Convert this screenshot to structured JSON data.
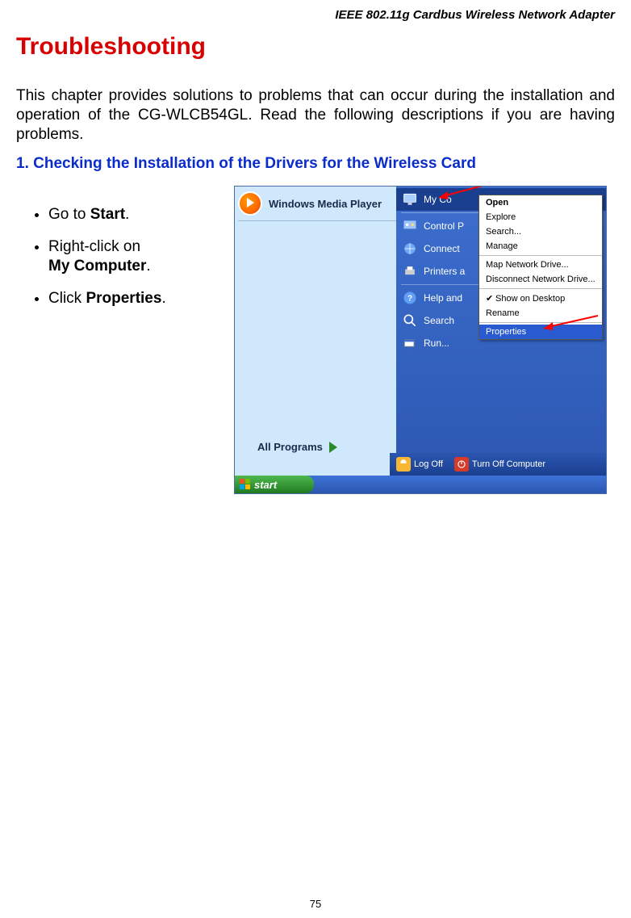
{
  "header": "IEEE 802.11g Cardbus Wireless Network Adapter",
  "title": "Troubleshooting",
  "intro": "This chapter provides solutions to problems that can occur during the installation and operation of the CG-WLCB54GL.  Read the following descriptions if you are having problems.",
  "section_heading": "1. Checking the Installation of the Drivers for the Wireless Card",
  "bullets": [
    {
      "prefix": "Go to ",
      "bold": "Start",
      "suffix": "."
    },
    {
      "prefix": "Right-click on",
      "bold": "My Computer",
      "suffix": "."
    },
    {
      "prefix": "Click ",
      "bold": "Properties",
      "suffix": "."
    }
  ],
  "screenshot": {
    "wmp_label": "Windows Media Player",
    "right_column": {
      "items": [
        {
          "label": "My Co",
          "icon": "monitor"
        },
        {
          "label": "Control P",
          "icon": "control-panel"
        },
        {
          "label": "Connect",
          "icon": "connect"
        },
        {
          "label": "Printers a",
          "icon": "printer"
        },
        {
          "label": "Help and",
          "icon": "help"
        },
        {
          "label": "Search",
          "icon": "search"
        },
        {
          "label": "Run...",
          "icon": "run"
        }
      ]
    },
    "context_menu": {
      "items": [
        {
          "label": "Open",
          "bold": true
        },
        {
          "label": "Explore"
        },
        {
          "label": "Search..."
        },
        {
          "label": "Manage"
        },
        {
          "divider": true
        },
        {
          "label": "Map Network Drive..."
        },
        {
          "label": "Disconnect Network Drive..."
        },
        {
          "divider": true
        },
        {
          "label": "Show on Desktop",
          "check": true
        },
        {
          "label": "Rename"
        },
        {
          "divider": true
        },
        {
          "label": "Properties",
          "selected": true
        }
      ]
    },
    "all_programs": "All Programs",
    "bottom_bar": {
      "logoff": "Log Off",
      "turnoff": "Turn Off Computer"
    },
    "start": "start"
  },
  "page_number": "75"
}
